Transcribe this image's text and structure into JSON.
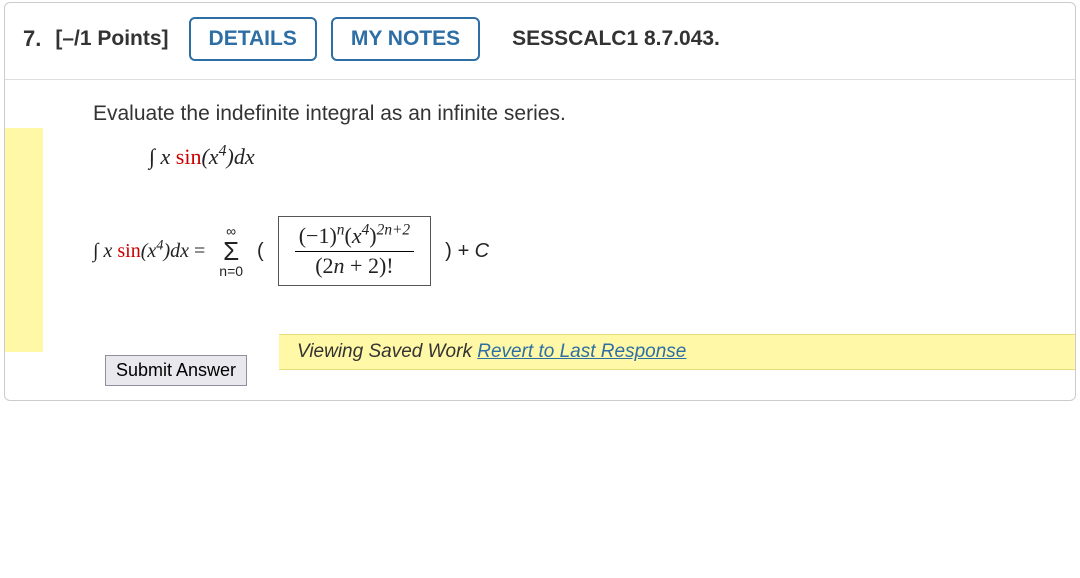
{
  "header": {
    "qnum": "7.",
    "points": "[–/1 Points]",
    "details_label": "DETAILS",
    "mynotes_label": "MY NOTES",
    "assignment": "SESSCALC1 8.7.043."
  },
  "prompt": "Evaluate the indefinite integral as an infinite series.",
  "integral": {
    "symbol": "∫",
    "var": "x",
    "fn": "sin",
    "inner_pre": "(x",
    "inner_exp": "4",
    "inner_post": ")dx"
  },
  "sigma": {
    "top": "∞",
    "mid": "Σ",
    "bot": "n=0"
  },
  "paren_open": "(",
  "paren_close": ")",
  "fraction": {
    "num_html": "(−1)<sup>n</sup>(<i>x</i><sup>4</sup>)<sup>2<i>n</i>+2</sup>",
    "den_html": "(2<i>n</i> + 2)!"
  },
  "trail": " + C",
  "saved_label": "Viewing Saved Work ",
  "revert_label": "Revert to Last Response",
  "submit_label": "Submit Answer",
  "chart_data": {
    "type": "table",
    "title": "Indefinite integral as infinite series",
    "question": "∫ x sin(x^4) dx",
    "answer_series_general_term": "(-1)^n (x^4)^(2n+2) / (2n+2)!",
    "sum_from": "n=0",
    "sum_to": "∞",
    "plus_constant": "C"
  }
}
